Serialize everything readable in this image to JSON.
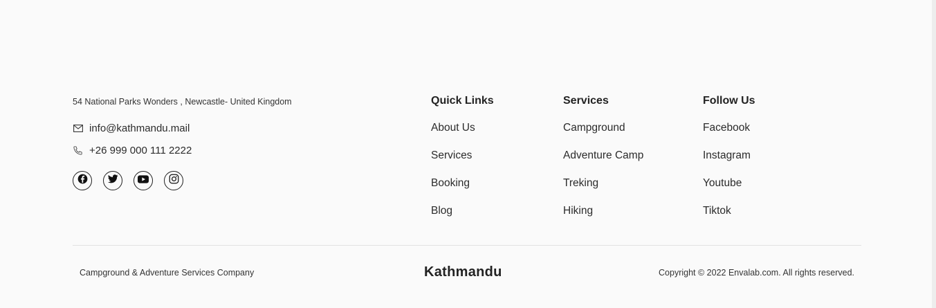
{
  "contact": {
    "address": "54 National Parks Wonders , Newcastle- United Kingdom",
    "email": "info@kathmandu.mail",
    "phone": "+26 999 000 111 2222"
  },
  "socials": [
    {
      "icon": "facebook-icon"
    },
    {
      "icon": "twitter-icon"
    },
    {
      "icon": "youtube-icon"
    },
    {
      "icon": "instagram-icon"
    }
  ],
  "quick_links": {
    "title": "Quick Links",
    "items": [
      "About Us",
      "Services",
      "Booking",
      "Blog"
    ]
  },
  "services": {
    "title": "Services",
    "items": [
      "Campground",
      "Adventure Camp",
      "Treking",
      "Hiking"
    ]
  },
  "follow_us": {
    "title": "Follow Us",
    "items": [
      "Facebook",
      "Instagram",
      "Youtube",
      "Tiktok"
    ]
  },
  "bottom": {
    "tagline": "Campground & Adventure Services Company",
    "brand": "Kathmandu",
    "copyright": "Copyright © 2022 Envalab.com. All rights reserved."
  },
  "colors": {
    "background": "#fafafa",
    "text": "#2b2b2b",
    "divider": "#e2e2e2"
  }
}
